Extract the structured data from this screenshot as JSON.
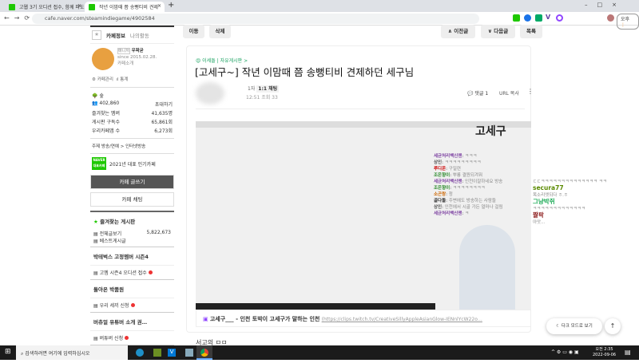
{
  "browser": {
    "tabs": [
      {
        "title": "고웹 3기 오디션 접수, 함께 파도"
      },
      {
        "title": "작년 이맘때 쯤 송뻥티비 견제"
      }
    ],
    "url": "cafe.naver.com/steamindiegame/4902584",
    "profile_label": "오후"
  },
  "sidebar": {
    "tab_info": "카페정보",
    "tab_activity": "나의활동",
    "manager_badge": "매니저",
    "manager": "우왁굳",
    "since": "since 2015.02.28.",
    "intro": "카페소개",
    "manage": "카페관리",
    "stats": "통계",
    "level": "숲",
    "members": "402,860",
    "invite": "초대하기",
    "fav_members_label": "즐겨찾는 멤버",
    "fav_members": "41,635명",
    "board_subs_label": "게시판 구독수",
    "board_subs": "65,861회",
    "app_members_label": "우리카페앱 수",
    "app_members": "6,273회",
    "topic": "주제  방송/연예 > 인터넷방송",
    "naver_badge": "NAVER 대표카페",
    "award": "2021년 대표 인기카페",
    "write": "카페 글쓰기",
    "chat": "카페 채팅",
    "fav_boards": "즐겨찾는 게시판",
    "items": [
      {
        "label": "전체글보기",
        "count": "5,822,673"
      },
      {
        "label": "베스트게시글"
      }
    ],
    "groups": [
      {
        "title": "박테벅스 고정멤버 시즌4",
        "items": [
          "고멤 시즌4 오디션 접수"
        ]
      },
      {
        "title": "돌아온 박품원",
        "items": [
          "우리 세끼 신청"
        ]
      },
      {
        "title": "버츄얼 유튜버 소개 권…",
        "items": [
          "버튜버 신청"
        ]
      },
      {
        "title": "트위치 공모전",
        "items": []
      }
    ]
  },
  "toolbar": {
    "move": "이동",
    "delete": "삭제",
    "prev": "이전글",
    "next": "다음글",
    "list": "목록"
  },
  "article": {
    "board": "이세돌 | 자유게시판 >",
    "title": "[고세구~] 작년 이맘때 쯤 송뻥티비 견제하던 세구님",
    "author_suffix": "1자",
    "chat_btn": "1:1 채팅",
    "meta": "12:51  조회 33",
    "comments": "댓글 1",
    "url_copy": "URL 복사",
    "link_title": "고세구___ - 인천 토박이 고세구가 말하는 인천",
    "link_url": "(https://clips.twitch.tv/CreativeSillyAppleAsianGlow-IENnlYcW22o…",
    "after_text": "서고의 ㅁㅁ"
  },
  "video": {
    "logo": "고세구",
    "chat": [
      {
        "user": "세균처리백신맨",
        "msg": "ㅋㅋㅋ",
        "color": "#7b3fa0"
      },
      {
        "user": "상인",
        "msg": "ㅋㅋㅋㅋㅋㅋㅋㅋㅋ",
        "color": "#555"
      },
      {
        "user": "루디온",
        "msg": "구일련",
        "color": "#c00"
      },
      {
        "user": "조은향이",
        "msg": "뿌룡 결원되겨뭐",
        "color": "#2a8a2a"
      },
      {
        "user": "세균처리백신맨",
        "msg": "인천이잘하네요 방송",
        "color": "#7b3fa0"
      },
      {
        "user": "조은향이",
        "msg": "ㅋㅋㅋㅋㅋㅋㅋㅋ",
        "color": "#2a8a2a"
      },
      {
        "user": "소곤랑",
        "msg": "청",
        "color": "#c60"
      },
      {
        "user": "골다돌",
        "msg": "주변에도 방송하는 사람들",
        "color": "#333"
      },
      {
        "user": "상인",
        "msg": "인천에서 시골 가든 얼마나 걸림",
        "color": "#555"
      },
      {
        "user": "세균처리백신맨",
        "msg": "ㅋ",
        "color": "#7b3fa0"
      }
    ]
  },
  "side_chat": [
    {
      "user": "",
      "msg": "ㄷㄷㅋㅋㅋㅋㅋㅋㅋㅋㅋㅋㅋㅋㅋㅋ ㅋㅋ",
      "color": "#999"
    },
    {
      "user": "secura77",
      "msg": "목소리엣되다 ㅎ.ㅎ",
      "color": "#5a8a00"
    },
    {
      "user": "그냥박쥐",
      "msg": "ㅋㅋㅋㅋㅋㅋㅋㅋㅋㅋㅋㅋㅋ",
      "color": "#1aaa55"
    },
    {
      "user": "짤팍",
      "msg": "아앗...",
      "color": "#8b1a1a"
    }
  ],
  "floating": {
    "dark_mode": "다크 모드로 보기"
  },
  "taskbar": {
    "search": "검색하려면 여기에 입력하십시오",
    "time": "오전 2:35",
    "date": "2022-09-06"
  }
}
